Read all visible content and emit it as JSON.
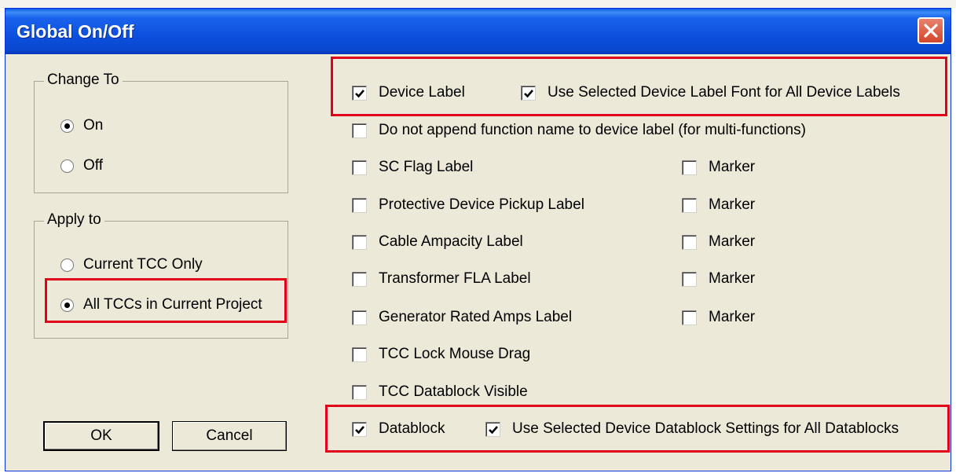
{
  "dialog": {
    "title": "Global On/Off"
  },
  "change_to": {
    "label": "Change To",
    "options": [
      {
        "label": "On",
        "selected": true
      },
      {
        "label": "Off",
        "selected": false
      }
    ]
  },
  "apply_to": {
    "label": "Apply to",
    "options": [
      {
        "label": "Current TCC Only",
        "selected": false
      },
      {
        "label": "All TCCs in Current Project",
        "selected": true
      }
    ]
  },
  "checkboxes": {
    "device_label": {
      "label": "Device Label",
      "checked": true
    },
    "use_selected_font": {
      "label": "Use Selected Device Label Font for All Device Labels",
      "checked": true
    },
    "no_append_function": {
      "label": "Do not append function name to device label (for multi-functions)",
      "checked": false
    },
    "sc_flag": {
      "label": "SC Flag Label",
      "checked": false
    },
    "sc_flag_marker": {
      "label": "Marker",
      "checked": false
    },
    "protective_pickup": {
      "label": "Protective Device Pickup Label",
      "checked": false
    },
    "protective_pickup_marker": {
      "label": "Marker",
      "checked": false
    },
    "cable_ampacity": {
      "label": "Cable Ampacity Label",
      "checked": false
    },
    "cable_ampacity_marker": {
      "label": "Marker",
      "checked": false
    },
    "transformer_fla": {
      "label": "Transformer FLA Label",
      "checked": false
    },
    "transformer_fla_marker": {
      "label": "Marker",
      "checked": false
    },
    "generator_amps": {
      "label": "Generator Rated Amps Label",
      "checked": false
    },
    "generator_amps_marker": {
      "label": "Marker",
      "checked": false
    },
    "tcc_lock": {
      "label": "TCC Lock Mouse Drag",
      "checked": false
    },
    "tcc_datablock_visible": {
      "label": "TCC Datablock Visible",
      "checked": false
    },
    "datablock": {
      "label": "Datablock",
      "checked": true
    },
    "use_selected_datablock": {
      "label": "Use Selected Device Datablock Settings for All Datablocks",
      "checked": true
    }
  },
  "buttons": {
    "ok": "OK",
    "cancel": "Cancel"
  },
  "colors": {
    "highlight": "#e0001a",
    "titlebar": "#0c50dd",
    "dialog_bg": "#ece9d8"
  }
}
